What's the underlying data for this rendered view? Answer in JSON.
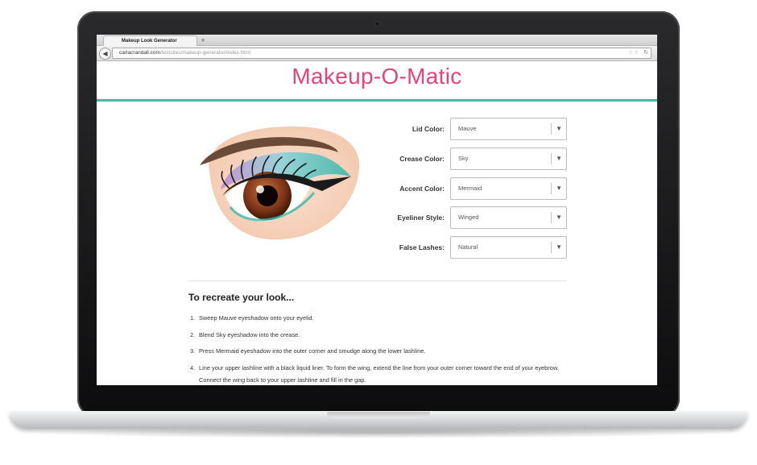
{
  "browser": {
    "tab_title": "Makeup Look Generator",
    "new_tab_label": "+",
    "url_host": "carlacrandall.com",
    "url_path": "/testsites/makeup-generator/index.html"
  },
  "page": {
    "title": "Makeup-O-Matic",
    "colors": {
      "title": "#e0457b",
      "rule": "#3fbfa8"
    }
  },
  "form": {
    "fields": [
      {
        "label": "Lid Color:",
        "value": "Mauve"
      },
      {
        "label": "Crease Color:",
        "value": "Sky"
      },
      {
        "label": "Accent Color:",
        "value": "Mermaid"
      },
      {
        "label": "Eyeliner Style:",
        "value": "Winged"
      },
      {
        "label": "False Lashes:",
        "value": "Natural"
      }
    ]
  },
  "instructions": {
    "heading": "To recreate your look...",
    "steps": [
      {
        "num": "1.",
        "text": "Sweep Mauve eyeshadow onto your eyelid."
      },
      {
        "num": "2.",
        "text": "Blend Sky eyeshadow into the crease."
      },
      {
        "num": "3.",
        "text": "Press Mermaid eyeshadow into the outer corner and smudge along the lower lashline."
      },
      {
        "num": "4.",
        "text": "Line your upper lashline with a black liquid liner. To form the wing, extend the line from your outer corner toward the end of your eyebrow. Connect the wing back to your upper lashline and fill in the gap."
      }
    ]
  }
}
